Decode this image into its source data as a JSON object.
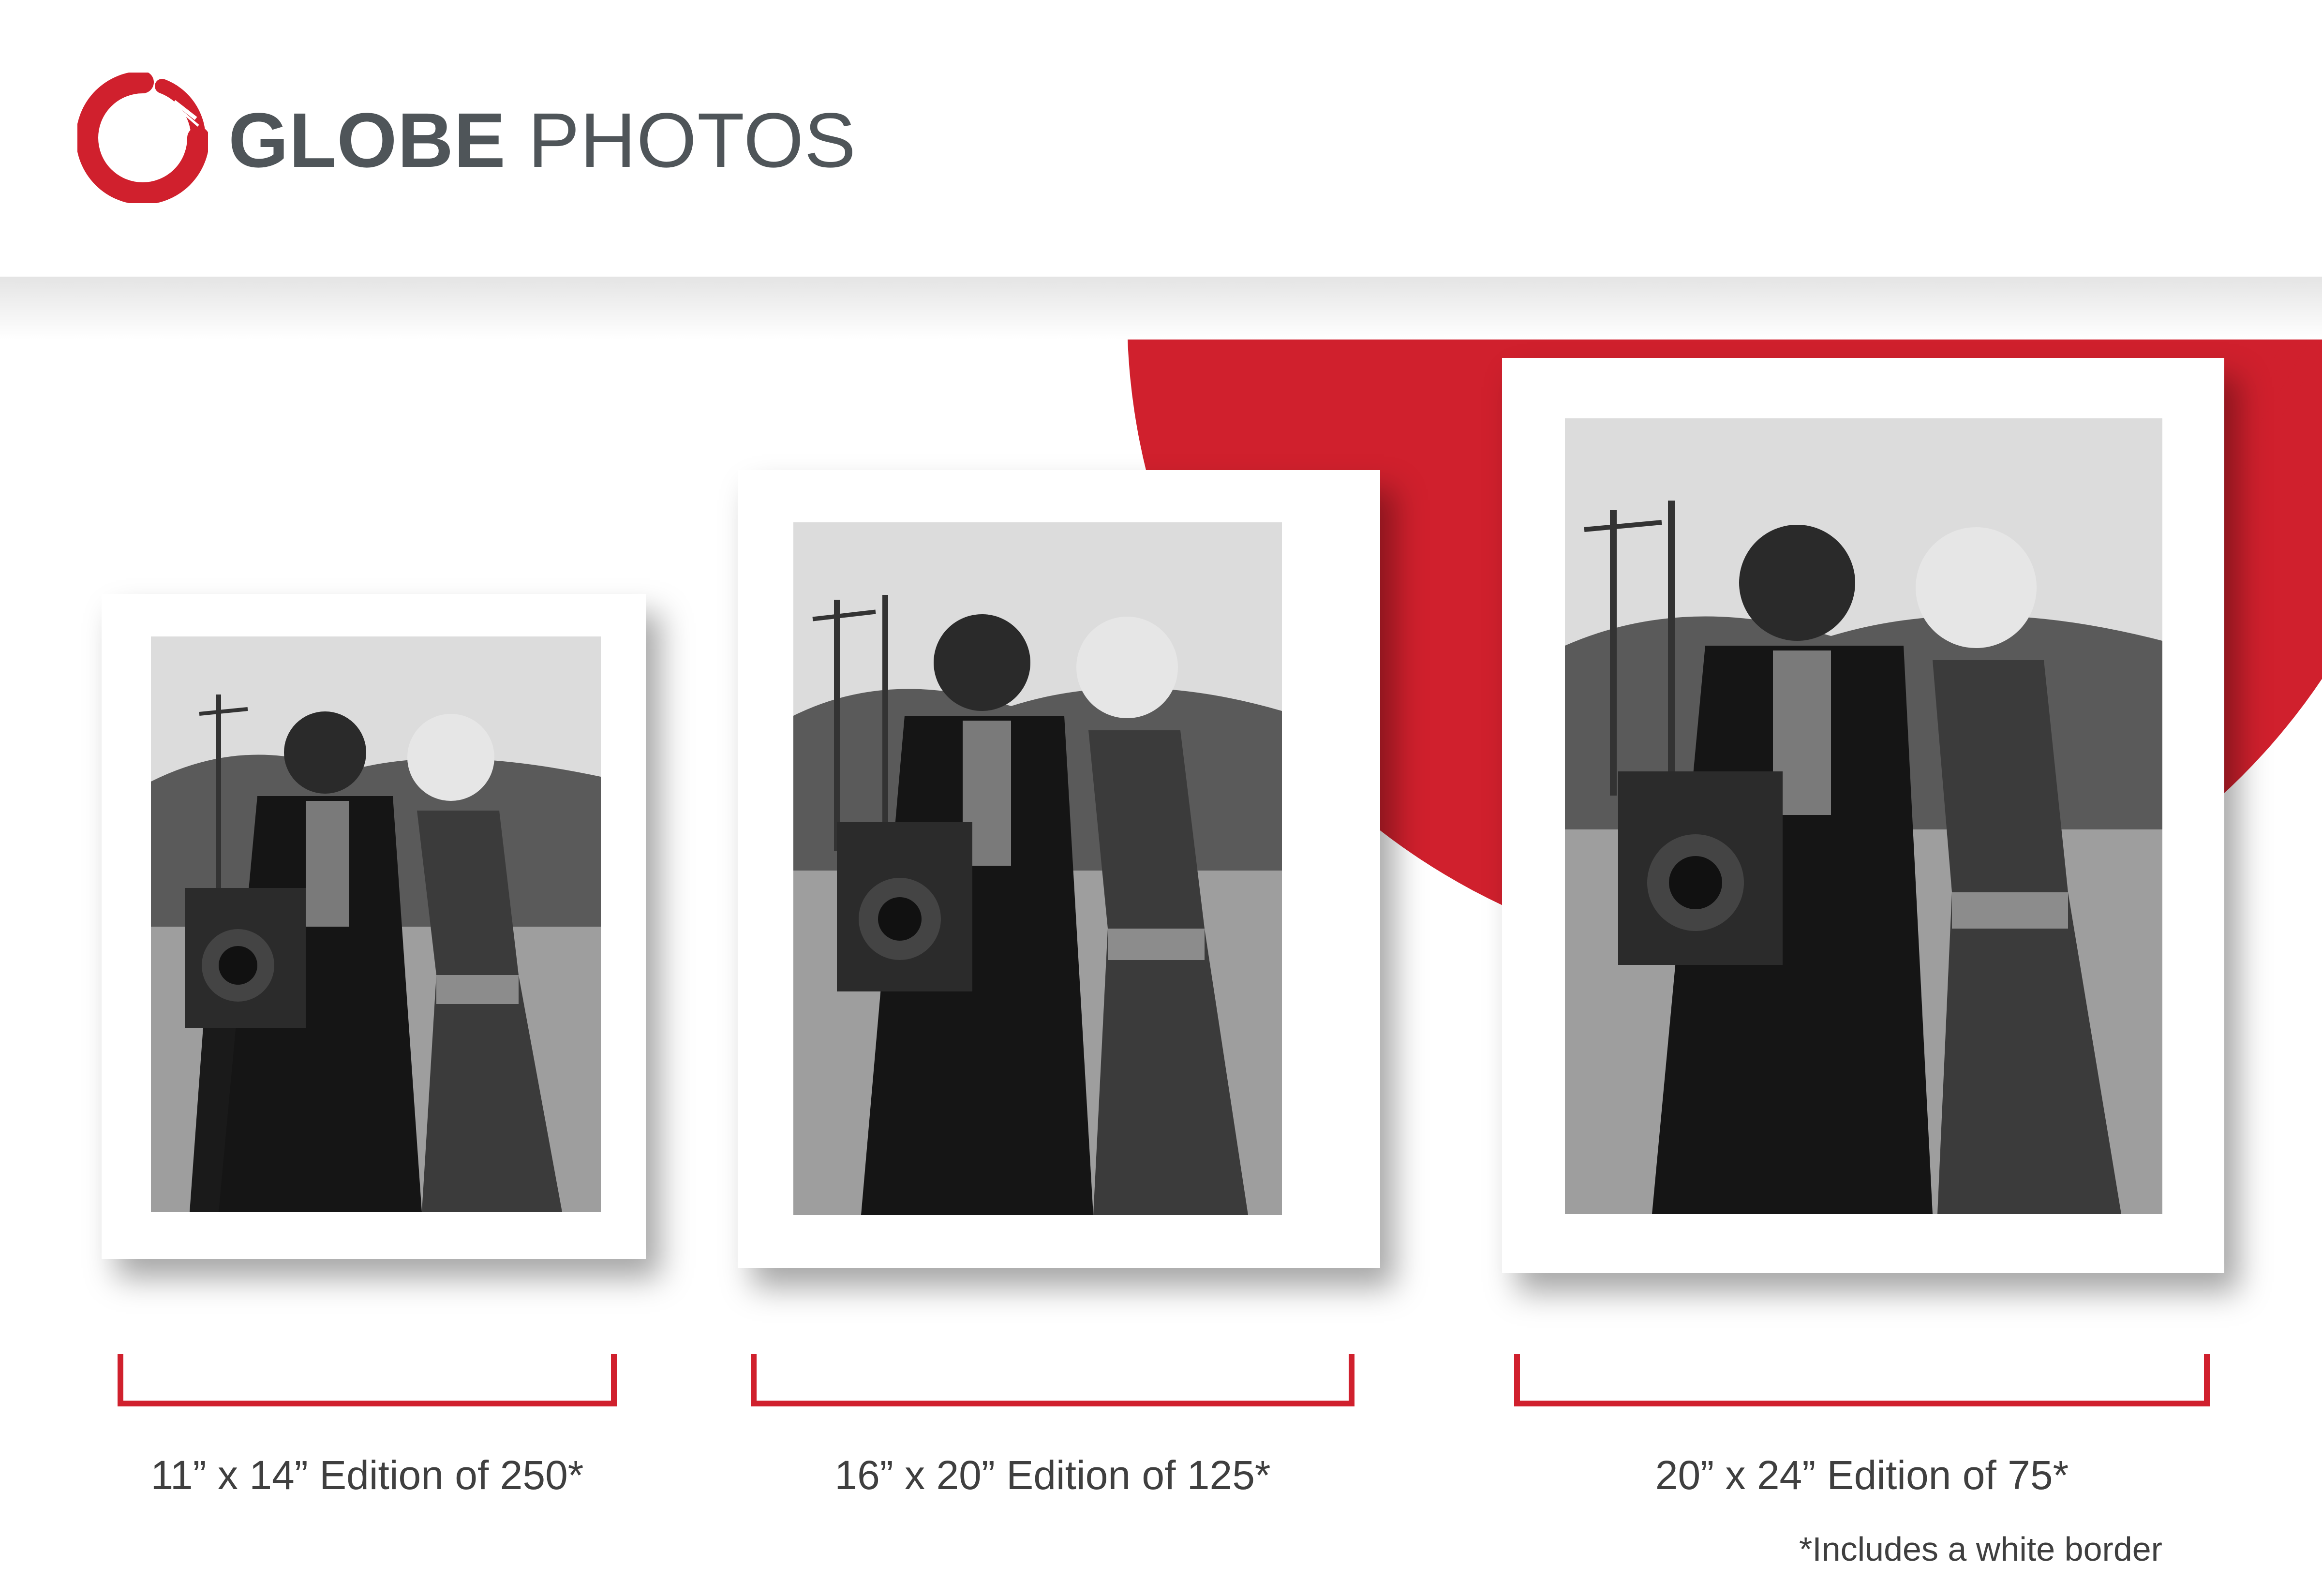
{
  "brand": {
    "name_bold": "GLOBE",
    "name_light": " PHOTOS",
    "accent_color": "#d0202d",
    "text_color": "#4f5559",
    "logo_icon": "brush-ring-icon"
  },
  "prints": [
    {
      "size": "11” x 14”",
      "edition": "Edition of 250*",
      "caption": "11” x 14” Edition of 250*"
    },
    {
      "size": "16” x 20”",
      "edition": "Edition of 125*",
      "caption": "16” x 20” Edition of 125*"
    },
    {
      "size": "20” x 24”",
      "edition": "Edition of 75*",
      "caption": "20” x 24” Edition of 75*"
    }
  ],
  "footnote": "*Includes a white border"
}
